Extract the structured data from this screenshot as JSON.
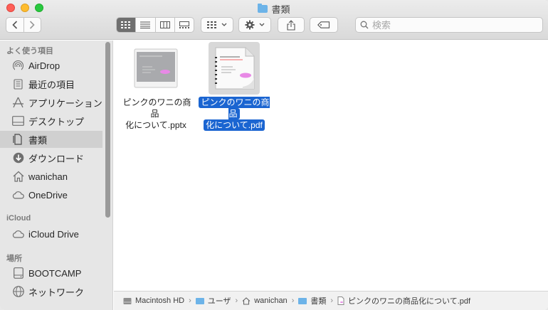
{
  "window": {
    "title": "書類"
  },
  "toolbar": {
    "back": "back",
    "forward": "forward",
    "views": [
      "icon",
      "list",
      "column",
      "gallery"
    ],
    "active_view": "icon",
    "search_placeholder": "検索"
  },
  "sidebar": {
    "sections": [
      {
        "heading": "よく使う項目",
        "items": [
          {
            "label": "AirDrop",
            "icon": "airdrop-icon"
          },
          {
            "label": "最近の項目",
            "icon": "recents-icon"
          },
          {
            "label": "アプリケーション",
            "icon": "applications-icon"
          },
          {
            "label": "デスクトップ",
            "icon": "desktop-icon"
          },
          {
            "label": "書類",
            "icon": "documents-icon",
            "selected": true
          },
          {
            "label": "ダウンロード",
            "icon": "downloads-icon"
          },
          {
            "label": "wanichan",
            "icon": "home-icon"
          },
          {
            "label": "OneDrive",
            "icon": "cloud-icon"
          }
        ]
      },
      {
        "heading": "iCloud",
        "items": [
          {
            "label": "iCloud Drive",
            "icon": "cloud-icon"
          }
        ]
      },
      {
        "heading": "場所",
        "items": [
          {
            "label": "BOOTCAMP",
            "icon": "disk-icon"
          },
          {
            "label": "ネットワーク",
            "icon": "network-icon"
          }
        ]
      }
    ]
  },
  "files": [
    {
      "name_line1": "ピンクのワニの商品",
      "name_line2": "化について.pptx",
      "selected": false,
      "thumb_title": "ピンクのワニの商品化について"
    },
    {
      "name_line1": "ピンクのワニの商品",
      "name_line2": "化について.pdf",
      "selected": true,
      "thumb_title": "ピンクのワニの商品化について"
    }
  ],
  "pathbar": [
    "Macintosh HD",
    "ユーザ",
    "wanichan",
    "書類",
    "ピンクのワニの商品化について.pdf"
  ],
  "colors": {
    "selection": "#1b65d1",
    "folder": "#6cb3e8",
    "pink": "#e889e6"
  }
}
